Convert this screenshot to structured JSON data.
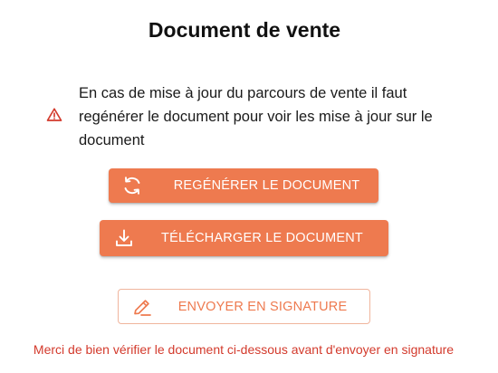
{
  "page": {
    "title": "Document de vente"
  },
  "warning": {
    "icon": "warning-triangle-icon",
    "text": "En cas de mise à jour du parcours de vente il faut regénérer le document pour voir les mise à jour sur le document",
    "color": "#d33a2c"
  },
  "actions": {
    "regenerate": {
      "label": "REGÉNÉRER LE DOCUMENT",
      "icon": "refresh-icon"
    },
    "download": {
      "label": "TÉLÉCHARGER LE DOCUMENT",
      "icon": "download-icon"
    },
    "signature": {
      "label": "ENVOYER EN SIGNATURE",
      "icon": "pen-icon"
    }
  },
  "footer": {
    "note": "Merci de bien vérifier le document ci-dessous avant d'envoyer en signature"
  },
  "colors": {
    "accent": "#ee7a4f",
    "accent_border": "#f0b59d",
    "error": "#d33a2c"
  }
}
